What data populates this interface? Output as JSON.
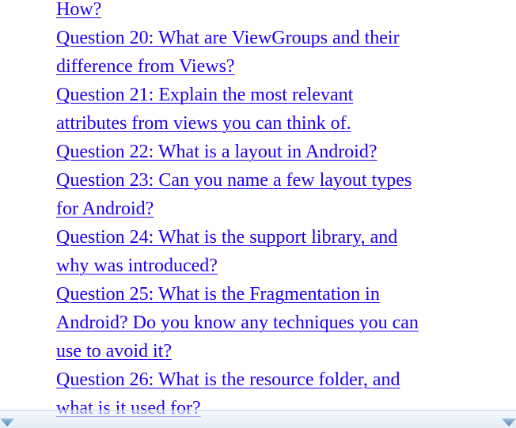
{
  "toc": {
    "items": [
      {
        "lines": [
          "How?"
        ]
      },
      {
        "lines": [
          "Question 20: What are ViewGroups and their",
          "difference from Views?"
        ]
      },
      {
        "lines": [
          "Question 21: Explain the most relevant",
          "attributes from views you can think of."
        ]
      },
      {
        "lines": [
          "Question 22: What is a layout in Android?"
        ]
      },
      {
        "lines": [
          "Question 23: Can you name a few layout types",
          "for Android?"
        ]
      },
      {
        "lines": [
          "Question 24: What is the support library, and",
          "why was introduced?"
        ]
      },
      {
        "lines": [
          "Question 25: What is the Fragmentation in",
          "Android? Do you know any techniques you can",
          "use to avoid it?"
        ]
      },
      {
        "lines": [
          "Question 26: What is the resource folder, and",
          "what is it used for?"
        ]
      }
    ]
  },
  "navigation": {
    "prev_icon": "triangle-down-icon",
    "next_icon": "triangle-down-icon"
  },
  "colors": {
    "link": "#1c00f0",
    "bar": "#dceaf6",
    "arrow": "#6f9fc6"
  }
}
